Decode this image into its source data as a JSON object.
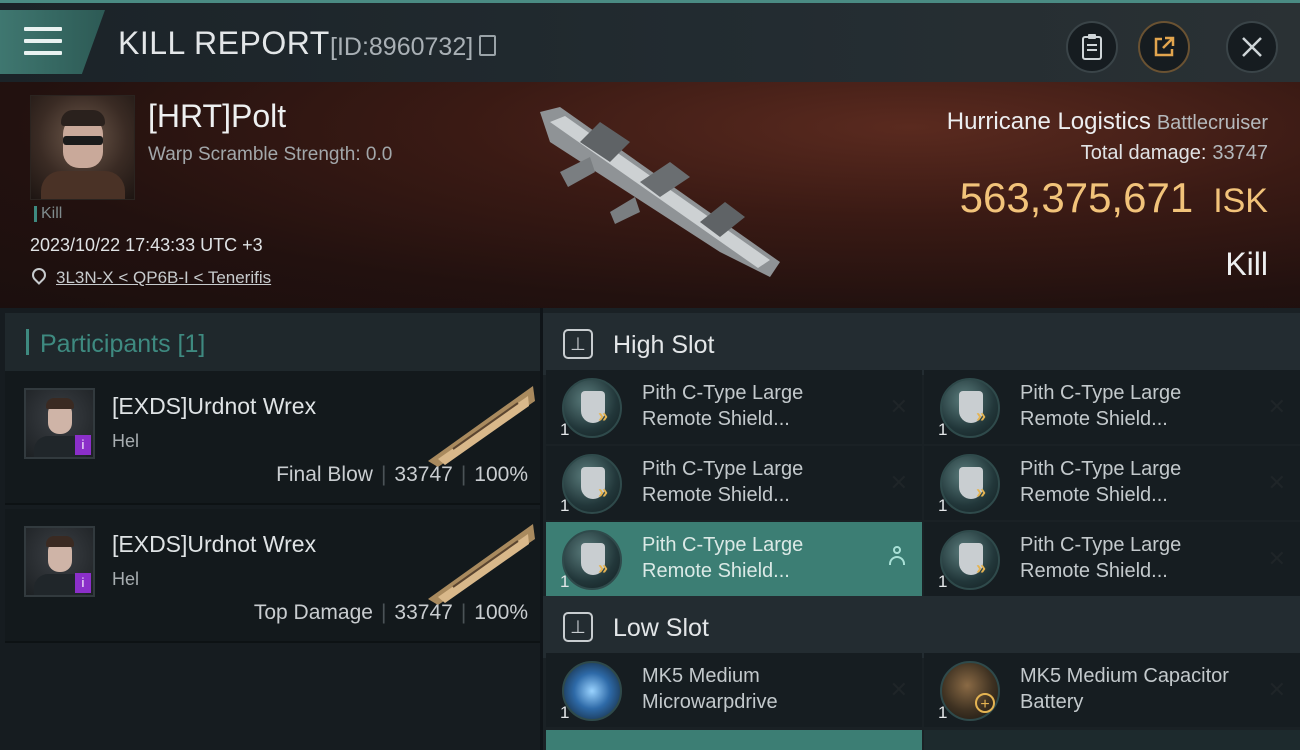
{
  "header": {
    "title": "KILL REPORT",
    "report_id": "[ID:8960732]"
  },
  "victim": {
    "name": "[HRT]Polt",
    "warp_scramble": "Warp Scramble Strength: 0.0",
    "tag": "Kill",
    "datetime": "2023/10/22 17:43:33 UTC +3",
    "location": "3L3N-X < QP6B-I < Tenerifis",
    "ship_name": "Hurricane Logistics",
    "ship_class": "Battlecruiser",
    "total_damage_label": "Total damage:",
    "total_damage": "33747",
    "isk_value": "563,375,671",
    "isk_unit": "ISK",
    "result": "Kill"
  },
  "participants": {
    "header": "Participants [1]",
    "items": [
      {
        "name": "[EXDS]Urdnot Wrex",
        "ship": "Hel",
        "role": "Final Blow",
        "damage": "33747",
        "percent": "100%",
        "badge": "i"
      },
      {
        "name": "[EXDS]Urdnot Wrex",
        "ship": "Hel",
        "role": "Top Damage",
        "damage": "33747",
        "percent": "100%",
        "badge": "i"
      }
    ]
  },
  "slots": {
    "high": {
      "label": "High Slot",
      "modules": [
        {
          "name": "Pith C-Type Large Remote Shield...",
          "qty": "1",
          "icon": "shield-booster-icon"
        },
        {
          "name": "Pith C-Type Large Remote Shield...",
          "qty": "1",
          "icon": "shield-booster-icon"
        },
        {
          "name": "Pith C-Type Large Remote Shield...",
          "qty": "1",
          "icon": "shield-booster-icon"
        },
        {
          "name": "Pith C-Type Large Remote Shield...",
          "qty": "1",
          "icon": "shield-booster-icon"
        },
        {
          "name": "Pith C-Type Large Remote Shield...",
          "qty": "1",
          "icon": "shield-booster-icon"
        },
        {
          "name": "Pith C-Type Large Remote Shield...",
          "qty": "1",
          "icon": "shield-booster-icon"
        }
      ]
    },
    "low": {
      "label": "Low Slot",
      "modules": [
        {
          "name": "MK5 Medium Microwarpdrive",
          "qty": "1",
          "icon": "microwarpdrive-icon"
        },
        {
          "name": "MK5 Medium Capacitor Battery",
          "qty": "1",
          "icon": "capacitor-battery-icon"
        }
      ]
    }
  },
  "colors": {
    "accent": "#3e8a80",
    "isk": "#f2c37a",
    "highlight": "#3c7e74",
    "badge": "#8b2fc9"
  }
}
